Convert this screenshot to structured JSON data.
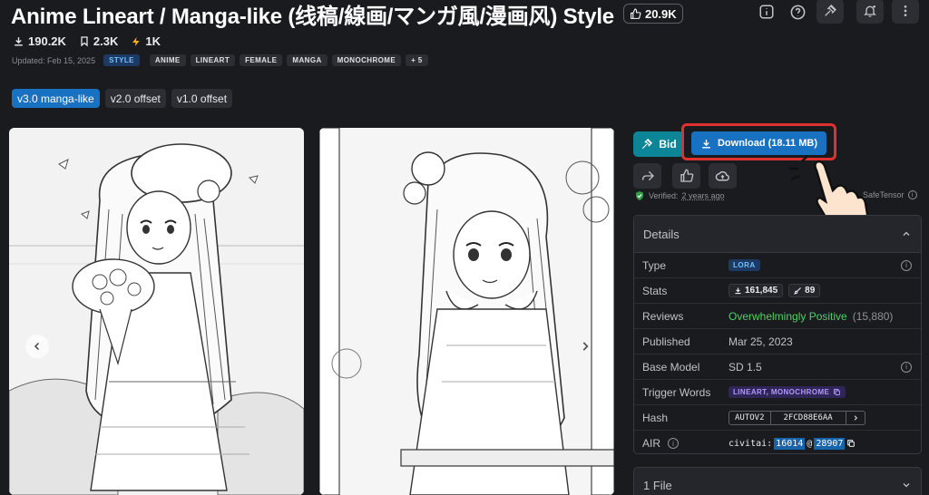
{
  "header": {
    "title": "Anime Lineart / Manga-like (线稿/線画/マンガ風/漫画风) Style",
    "likes": "20.9K"
  },
  "stats": {
    "downloads": "190.2K",
    "bookmarks": "2.3K",
    "buzz": "1K"
  },
  "meta": {
    "updated": "Updated: Feb 15, 2025",
    "type_tag": "STYLE",
    "tags": [
      "ANIME",
      "LINEART",
      "FEMALE",
      "MANGA",
      "MONOCHROME",
      "+ 5"
    ]
  },
  "versions": [
    {
      "label": "v3.0 manga-like",
      "active": true
    },
    {
      "label": "v2.0 offset",
      "active": false
    },
    {
      "label": "v1.0 offset",
      "active": false
    }
  ],
  "actions": {
    "bid_label": "Bid",
    "download_label": "Download (18.11 MB)"
  },
  "verified": {
    "label": "Verified:",
    "when": "2 years ago",
    "format": "SafeTensor"
  },
  "details": {
    "title": "Details",
    "rows": {
      "type": {
        "label": "Type",
        "value": "LORA"
      },
      "stats": {
        "label": "Stats",
        "downloads": "161,845",
        "generations": "89"
      },
      "reviews": {
        "label": "Reviews",
        "value": "Overwhelmingly Positive",
        "count": "(15,880)"
      },
      "published": {
        "label": "Published",
        "value": "Mar 25, 2023"
      },
      "base_model": {
        "label": "Base Model",
        "value": "SD 1.5"
      },
      "trigger": {
        "label": "Trigger Words",
        "value": "LINEART, MONOCHROME"
      },
      "hash": {
        "label": "Hash",
        "algo": "AUTOV2",
        "value": "2FCD88E6AA"
      },
      "air": {
        "label": "AIR",
        "prefix": "civitai:",
        "model_id": "16014",
        "at": "@",
        "version_id": "28907"
      }
    }
  },
  "files": {
    "title": "1 File"
  },
  "colors": {
    "accent": "#1971c2",
    "teal": "#0c8599",
    "highlight": "#e03131",
    "positive": "#51cf66"
  }
}
